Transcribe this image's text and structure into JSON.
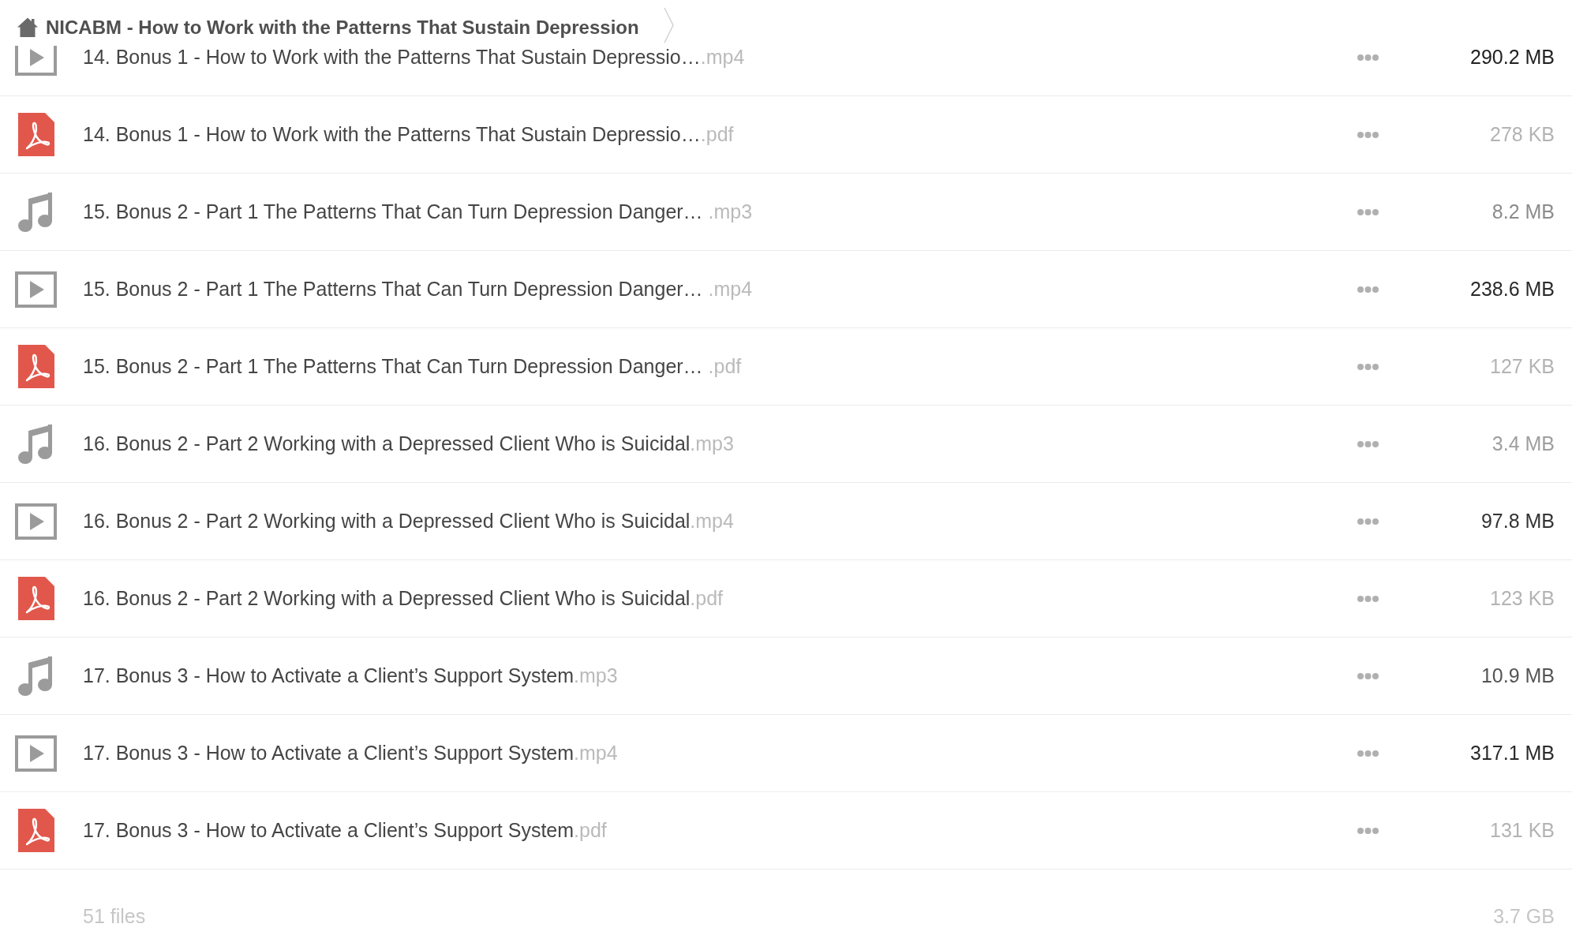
{
  "breadcrumb": {
    "title": "NICABM - How to Work with the Patterns That Sustain Depression"
  },
  "files": [
    {
      "kind": "video",
      "name": "14. Bonus 1 - How to Work with the Patterns That Sustain Depressio…",
      "extension": ".mp4",
      "size": {
        "text": "290.2 MB",
        "color": "#222222"
      }
    },
    {
      "kind": "pdf",
      "name": "14. Bonus 1 - How to Work with the Patterns That Sustain Depressio…",
      "extension": ".pdf",
      "size": {
        "text": "278 KB",
        "color": "#b3b3b3"
      }
    },
    {
      "kind": "audio",
      "name": "15. Bonus 2 - Part 1 The Patterns That Can Turn Depression Danger… ",
      "extension": ".mp3",
      "size": {
        "text": "8.2 MB",
        "color": "#8c8c8c"
      }
    },
    {
      "kind": "video",
      "name": "15. Bonus 2 - Part 1 The Patterns That Can Turn Depression Danger… ",
      "extension": ".mp4",
      "size": {
        "text": "238.6 MB",
        "color": "#2a2a2a"
      }
    },
    {
      "kind": "pdf",
      "name": "15. Bonus 2 - Part 1 The Patterns That Can Turn Depression Danger… ",
      "extension": ".pdf",
      "size": {
        "text": "127 KB",
        "color": "#b3b3b3"
      }
    },
    {
      "kind": "audio",
      "name": "16. Bonus 2 - Part 2 Working with a Depressed Client Who is Suicidal",
      "extension": ".mp3",
      "size": {
        "text": "3.4 MB",
        "color": "#9e9e9e"
      }
    },
    {
      "kind": "video",
      "name": "16. Bonus 2 - Part 2 Working with a Depressed Client Who is Suicidal",
      "extension": ".mp4",
      "size": {
        "text": "97.8 MB",
        "color": "#333333"
      }
    },
    {
      "kind": "pdf",
      "name": "16. Bonus 2 - Part 2 Working with a Depressed Client Who is Suicidal",
      "extension": ".pdf",
      "size": {
        "text": "123 KB",
        "color": "#b3b3b3"
      }
    },
    {
      "kind": "audio",
      "name": "17. Bonus 3 - How to Activate a Client’s Support System",
      "extension": ".mp3",
      "size": {
        "text": "10.9 MB",
        "color": "#555555"
      }
    },
    {
      "kind": "video",
      "name": "17. Bonus 3 - How to Activate a Client’s Support System",
      "extension": ".mp4",
      "size": {
        "text": "317.1 MB",
        "color": "#2a2a2a"
      }
    },
    {
      "kind": "pdf",
      "name": "17. Bonus 3 - How to Activate a Client’s Support System",
      "extension": ".pdf",
      "size": {
        "text": "131 KB",
        "color": "#b3b3b3"
      }
    }
  ],
  "footer": {
    "count": "51 files",
    "total": "3.7 GB"
  }
}
